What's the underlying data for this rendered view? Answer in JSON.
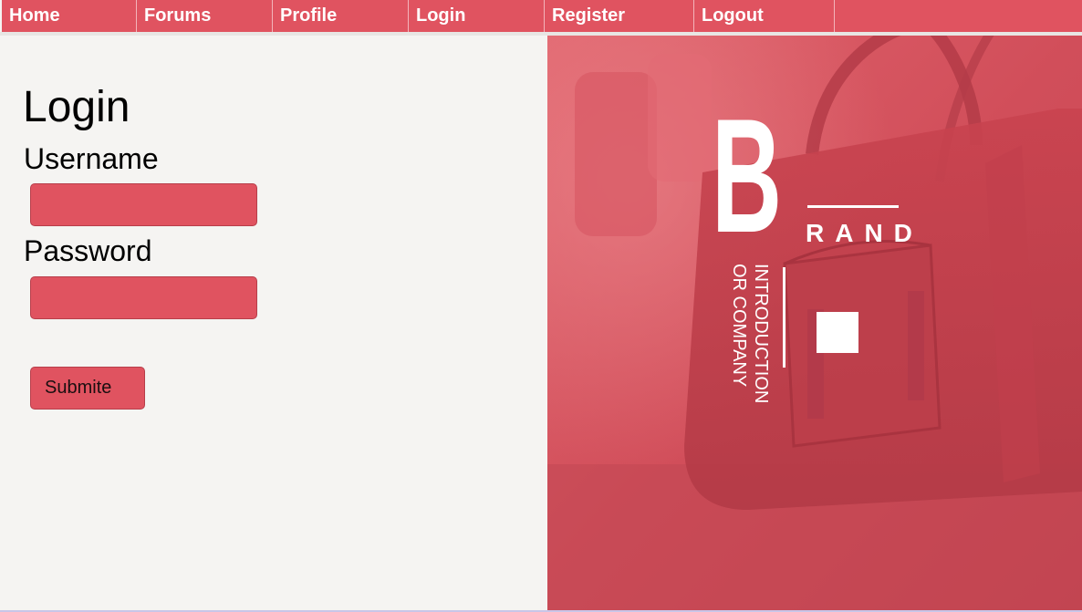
{
  "nav": {
    "items": [
      {
        "label": "Home"
      },
      {
        "label": "Forums"
      },
      {
        "label": "Profile"
      },
      {
        "label": "Login"
      },
      {
        "label": "Register"
      },
      {
        "label": "Logout"
      }
    ]
  },
  "login": {
    "title": "Login",
    "username_label": "Username",
    "username_value": "",
    "password_label": "Password",
    "password_value": "",
    "submit_label": "Submite"
  },
  "brand": {
    "letter": "B",
    "rest": "RAND",
    "tagline_line1": "INTRODUCTION",
    "tagline_line2": "OR COMPANY"
  },
  "colors": {
    "accent": "#e05360",
    "page_background": "#f5f4f2",
    "brand_text": "#ffffff"
  }
}
